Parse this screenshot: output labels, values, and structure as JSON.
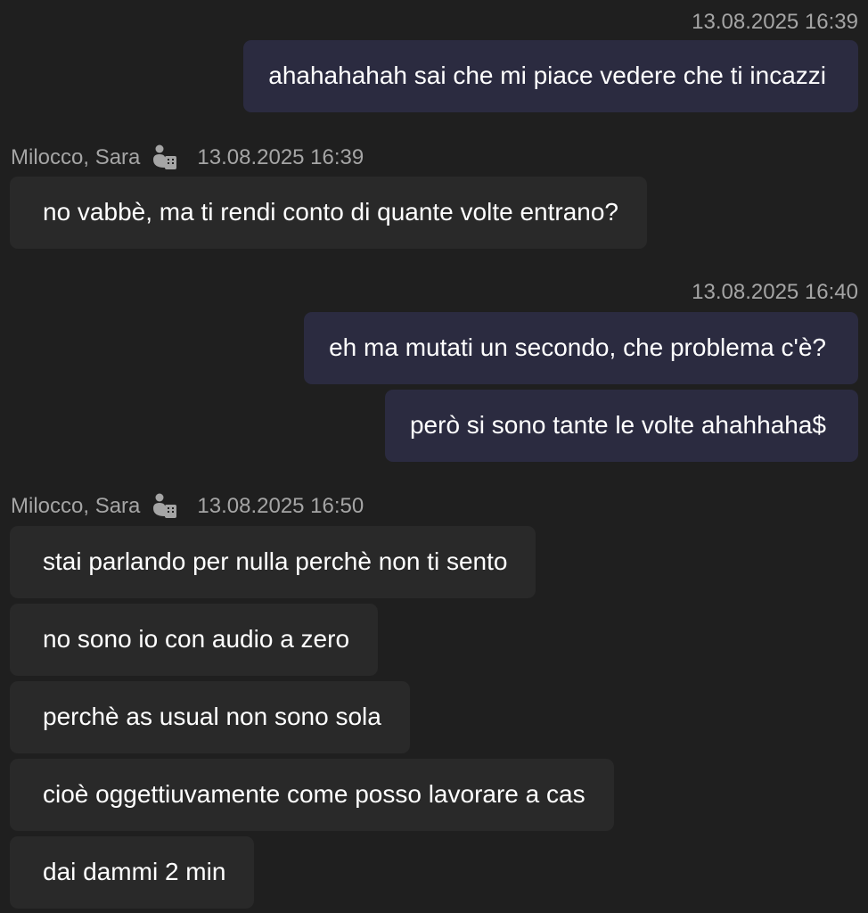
{
  "conversation": {
    "groups": [
      {
        "own": true,
        "timestamp": "13.08.2025 16:39",
        "messages": [
          "ahahahahah sai che mi piace vedere che ti incazzi"
        ]
      },
      {
        "own": false,
        "sender": "Milocco, Sara",
        "sender_icon": "external-org-icon",
        "timestamp": "13.08.2025 16:39",
        "messages": [
          "no vabbè, ma ti rendi conto di quante volte entrano?"
        ]
      },
      {
        "own": true,
        "timestamp": "13.08.2025 16:40",
        "messages": [
          "eh ma mutati un secondo, che problema c'è?",
          "però si sono tante le volte ahahhaha$"
        ]
      },
      {
        "own": false,
        "sender": "Milocco, Sara",
        "sender_icon": "external-org-icon",
        "timestamp": "13.08.2025 16:50",
        "messages": [
          "stai parlando per nulla perchè non ti sento",
          "no sono io con audio a zero",
          "perchè as usual non sono sola",
          "cioè oggettiuvamente come posso lavorare a cas",
          "dai dammi 2 min"
        ]
      }
    ]
  },
  "colors": {
    "background": "#1f1f1f",
    "own_bubble": "#2b2b40",
    "other_bubble": "#292929",
    "meta_text": "#a5a5a5",
    "message_text": "#ffffff"
  }
}
